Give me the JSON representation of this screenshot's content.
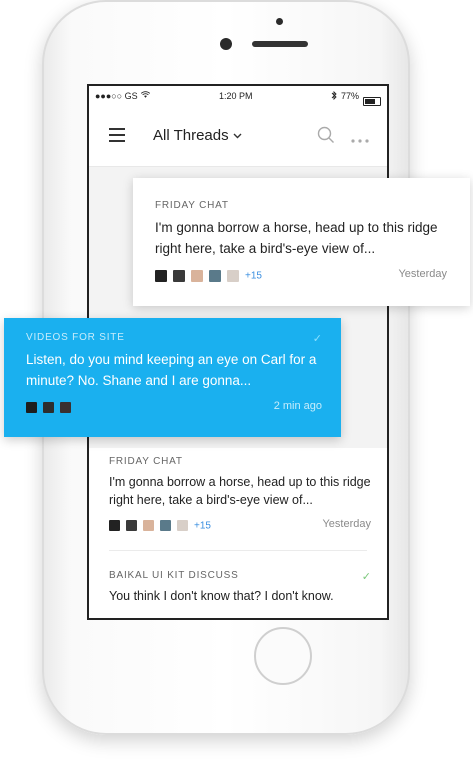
{
  "statusbar": {
    "carrier": "●●●○○ GS",
    "time": "1:20 PM",
    "battery": "77%"
  },
  "navbar": {
    "title": "All Threads",
    "chevron": "⌄"
  },
  "threads": [
    {
      "label": "FRIDAY CHAT",
      "message": "I'm gonna borrow a horse, head up to this ridge right here, take a bird's-eye view of...",
      "more": "+15",
      "time": "Yesterday"
    },
    {
      "label": "VIDEOS FOR SITE",
      "message": "Listen, do you mind keeping an eye on Carl for a minute? No. Shane and I are gonna...",
      "time": "2 min ago",
      "check": "✓"
    },
    {
      "label": "FRIDAY CHAT",
      "message": "I'm gonna borrow a horse, head up to this ridge right here, take a bird's-eye view of...",
      "more": "+15",
      "time": "Yesterday"
    },
    {
      "label": "BAIKAL UI KIT DISCUSS",
      "message": "You think I don't know that? I don't know.",
      "check": "✓"
    }
  ],
  "colors": {
    "accent": "#1ab0ef",
    "link": "#3b8fe0",
    "check_green": "#7bc87b"
  },
  "icons": [
    "menu-icon",
    "chevron-down-icon",
    "search-icon",
    "more-icon",
    "check-icon",
    "wifi-icon",
    "bluetooth-icon",
    "battery-icon"
  ]
}
